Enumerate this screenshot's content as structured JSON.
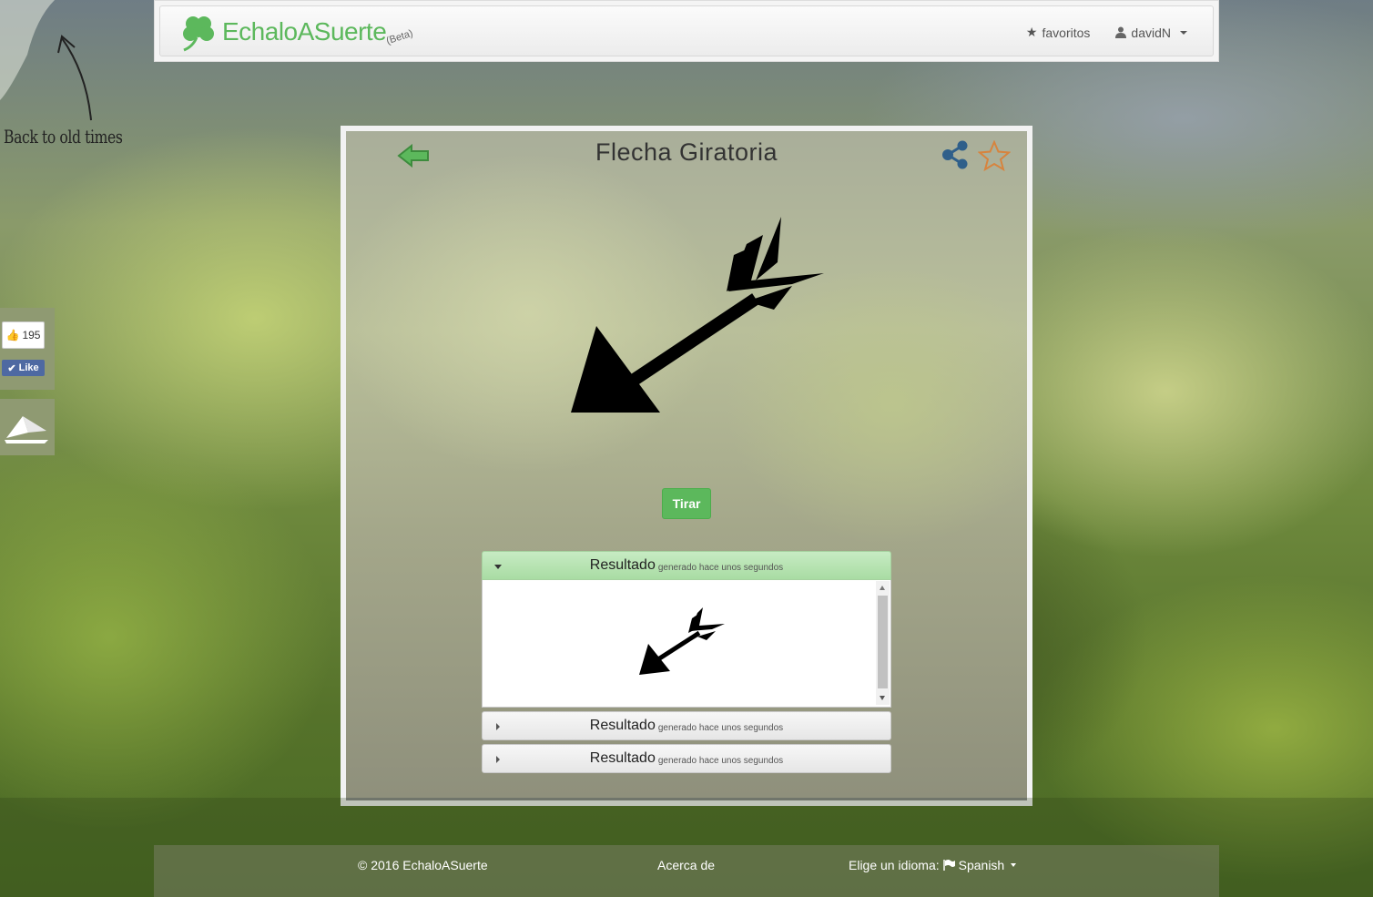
{
  "navbar": {
    "brand": "EchaloASuerte",
    "beta": "(Beta)",
    "favorites_label": "favoritos",
    "user_label": "davidN"
  },
  "sidebar_note": "Back to old times",
  "social": {
    "like_count": "195",
    "like_label": "Like"
  },
  "draw": {
    "title": "Flecha Giratoria",
    "toss_label": "Tirar",
    "results": [
      {
        "label": "Resultado",
        "sub": "generado hace unos segundos",
        "expanded": true
      },
      {
        "label": "Resultado",
        "sub": "generado hace unos segundos",
        "expanded": false
      },
      {
        "label": "Resultado",
        "sub": "generado hace unos segundos",
        "expanded": false
      }
    ]
  },
  "footer": {
    "copyright": "© 2016 EchaloASuerte",
    "about": "Acerca de",
    "language_prompt": "Elige un idioma:",
    "language": "Spanish"
  },
  "colors": {
    "brand_green": "#5cb85c",
    "like_blue": "#4e69a2",
    "star_orange": "#d7843e",
    "share_blue": "#2f5f8a"
  },
  "icons": [
    "clover-icon",
    "star-icon",
    "user-icon",
    "thumbs-up-icon",
    "check-icon",
    "paper-plane-icon",
    "back-arrow-icon",
    "share-icon",
    "favorite-star-icon",
    "arrow-icon",
    "flag-icon"
  ]
}
